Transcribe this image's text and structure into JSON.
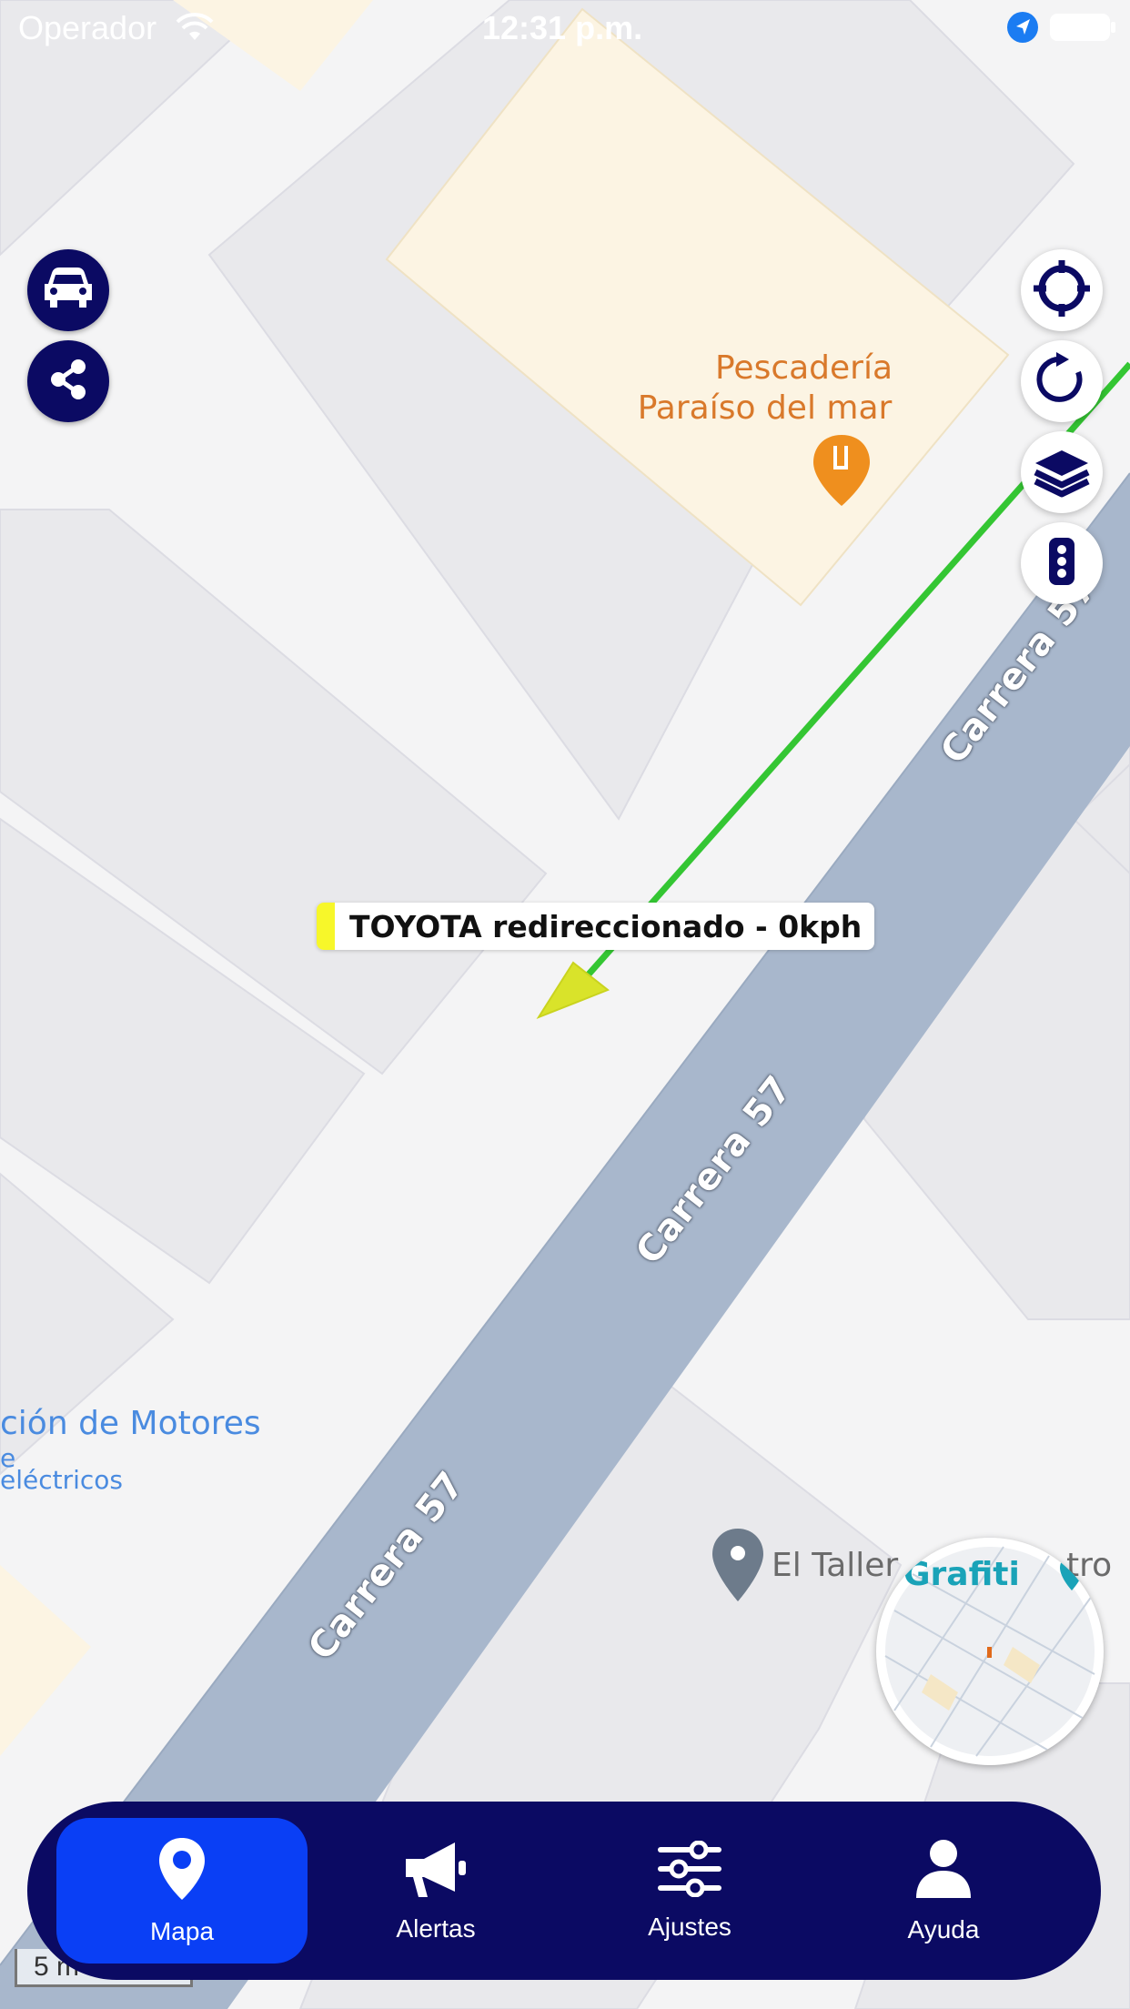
{
  "status_bar": {
    "carrier": "Operador",
    "time": "12:31 p.m."
  },
  "map": {
    "poi_restaurant": {
      "line1": "Pescadería",
      "line2": "Paraíso del mar"
    },
    "poi_motors": {
      "line1": "ción de Motores",
      "line2": "e",
      "line3": "eléctricos"
    },
    "poi_taller": "El Taller",
    "poi_taller_suffix": "tro",
    "poi_grafiti": "Grafiti",
    "road_name": "Carrera 57",
    "route_color": "#34c633",
    "vehicle_color": "#d9e32a"
  },
  "vehicle": {
    "label": "TOYOTA redireccionado - 0kph"
  },
  "scale": "5 m",
  "left_buttons": [
    {
      "icon": "car-icon"
    },
    {
      "icon": "share-icon"
    }
  ],
  "right_buttons": [
    {
      "icon": "crosshair-icon"
    },
    {
      "icon": "refresh-icon"
    },
    {
      "icon": "layers-icon"
    },
    {
      "icon": "traffic-light-icon"
    }
  ],
  "nav": {
    "items": [
      {
        "label": "Mapa",
        "icon": "map-pin-icon",
        "active": true
      },
      {
        "label": "Alertas",
        "icon": "megaphone-icon",
        "active": false
      },
      {
        "label": "Ajustes",
        "icon": "sliders-icon",
        "active": false
      },
      {
        "label": "Ayuda",
        "icon": "user-icon",
        "active": false
      }
    ]
  },
  "colors": {
    "nav_bg": "#0b0a63",
    "nav_active": "#0a3ff5",
    "road": "#a8b7cc"
  }
}
